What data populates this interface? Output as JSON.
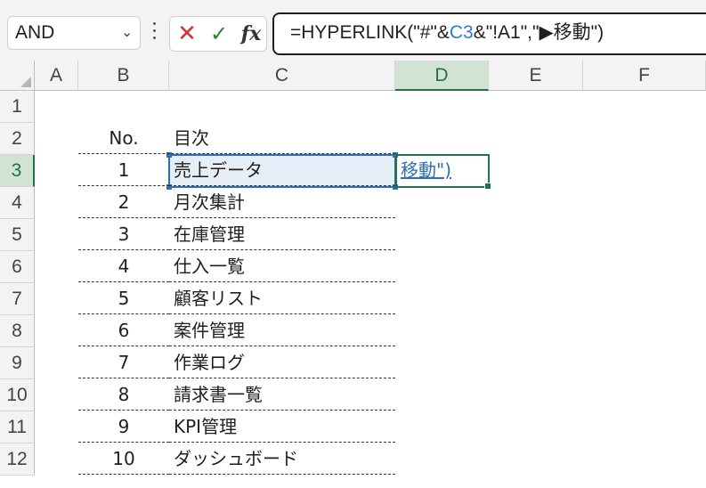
{
  "formula_bar": {
    "name_box": "AND",
    "formula_before_ref": "=HYPERLINK(\"#\"&",
    "formula_ref": "C3",
    "formula_after_ref": "&\"!A1\",\"▶移動\")"
  },
  "columns": [
    "A",
    "B",
    "C",
    "D",
    "E",
    "F"
  ],
  "rows": [
    "1",
    "2",
    "3",
    "4",
    "5",
    "6",
    "7",
    "8",
    "9",
    "10",
    "11",
    "12"
  ],
  "active": {
    "column": "D",
    "row": "3"
  },
  "colors": {
    "ref_blue": "#2e7bd6",
    "active_green": "#217346",
    "link": "#2e6eb5"
  },
  "table": {
    "header_no": "No.",
    "header_toc": "目次",
    "items": [
      {
        "no": "1",
        "name": "売上データ"
      },
      {
        "no": "2",
        "name": "月次集計"
      },
      {
        "no": "3",
        "name": "在庫管理"
      },
      {
        "no": "4",
        "name": "仕入一覧"
      },
      {
        "no": "5",
        "name": "顧客リスト"
      },
      {
        "no": "6",
        "name": "案件管理"
      },
      {
        "no": "7",
        "name": "作業ログ"
      },
      {
        "no": "8",
        "name": "請求書一覧"
      },
      {
        "no": "9",
        "name": "KPI管理"
      },
      {
        "no": "10",
        "name": "ダッシュボード"
      }
    ]
  },
  "d3_display": "移動\")"
}
